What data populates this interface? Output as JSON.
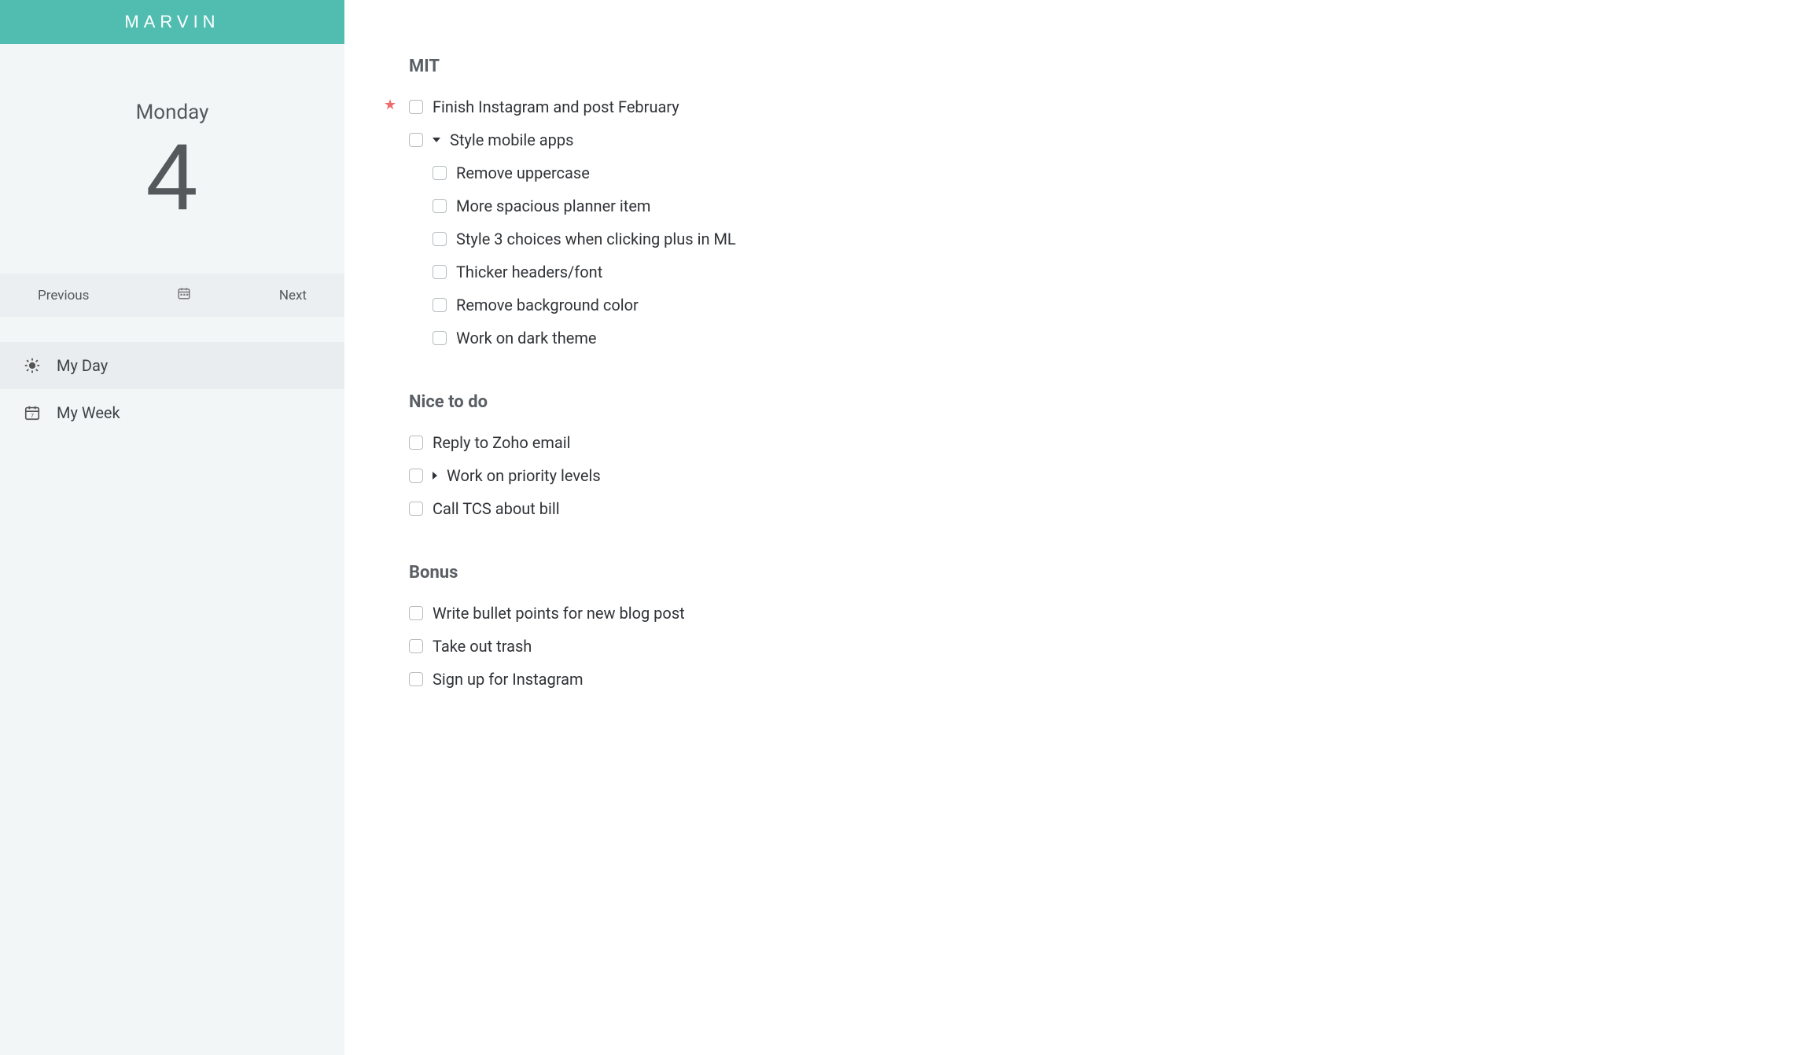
{
  "brand": "MARVIN",
  "date": {
    "dow": "Monday",
    "day": "4"
  },
  "nav": {
    "prev": "Previous",
    "next": "Next"
  },
  "side": {
    "myday": "My Day",
    "myweek": "My Week"
  },
  "sections": {
    "mit": {
      "title": "MIT",
      "t0": "Finish Instagram and post February",
      "t1": "Style mobile apps",
      "t1_children": {
        "c0": "Remove uppercase",
        "c1": "More spacious planner item",
        "c2": "Style 3 choices when clicking plus in ML",
        "c3": "Thicker headers/font",
        "c4": "Remove background color",
        "c5": "Work on dark theme"
      }
    },
    "nice": {
      "title": "Nice to do",
      "t0": "Reply to Zoho email",
      "t1": "Work on priority levels",
      "t2": "Call TCS about bill"
    },
    "bonus": {
      "title": "Bonus",
      "t0": "Write bullet points for new blog post",
      "t1": "Take out trash",
      "t2": "Sign up for Instagram"
    }
  }
}
